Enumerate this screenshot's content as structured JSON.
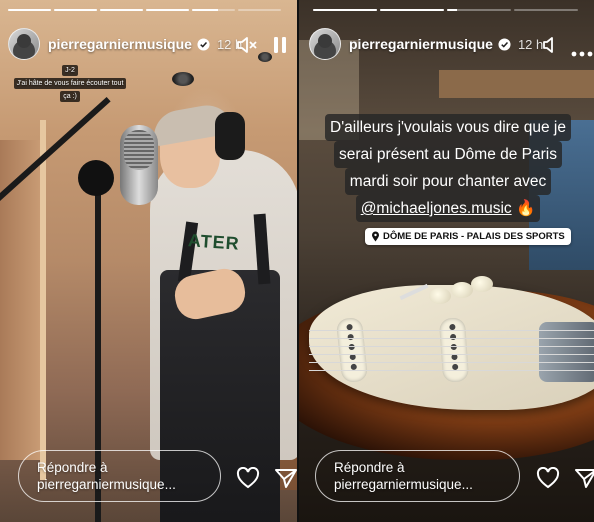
{
  "left_story": {
    "username": "pierregarniermusique",
    "time": "12 h",
    "progress": [
      1,
      1,
      1,
      1,
      0.6,
      0
    ],
    "caption_lines": [
      "J-2",
      "J'ai hâte de vous faire écouter tout",
      "ça :)"
    ],
    "hoodie_print": "ATER",
    "reply_line1": "Répondre à",
    "reply_line2": "pierregarniermusique..."
  },
  "right_story": {
    "username": "pierregarniermusique",
    "time": "12 h",
    "progress": [
      1,
      1,
      0.15,
      0
    ],
    "caption_lines": [
      "D'ailleurs j'voulais vous dire que je",
      "serai présent au Dôme de Paris",
      "mardi soir pour chanter avec"
    ],
    "mention": "@michaeljones.music",
    "mention_emoji": "🔥",
    "location": "DÔME DE  PARIS - PALAIS DES SPORTS",
    "reply_line1": "Répondre à",
    "reply_line2": "pierregarniermusique..."
  },
  "icons": {
    "verified": "verified-badge-icon",
    "mute": "speaker-muted-icon",
    "pause": "pause-icon",
    "more": "more-options-icon",
    "like": "heart-icon",
    "share": "send-icon",
    "location": "location-pin-icon"
  },
  "colors": {
    "verified": "#3897f0",
    "text": "#ffffff"
  }
}
